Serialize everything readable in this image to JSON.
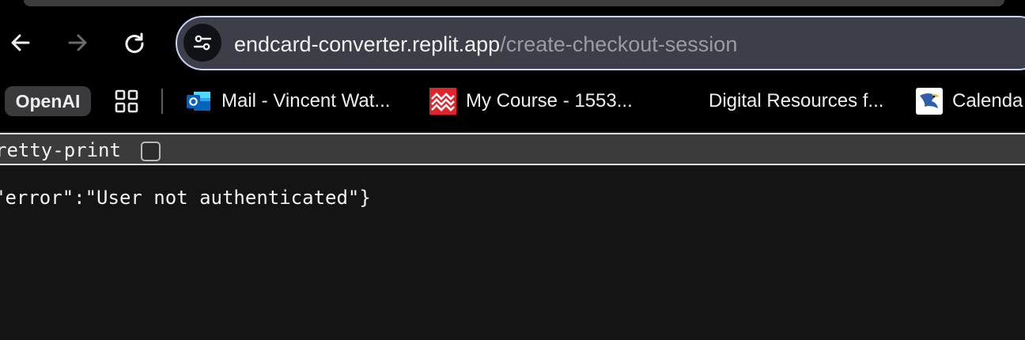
{
  "browser": {
    "url_host": "endcard-converter.replit.app",
    "url_path": "/create-checkout-session"
  },
  "bookmarks": {
    "chip_label": "OpenAI",
    "items": [
      {
        "label": "Mail - Vincent Wat...",
        "icon": "outlook-icon"
      },
      {
        "label": "My Course - 1553...",
        "icon": "mcgraw-hill-icon"
      },
      {
        "label": "Digital Resources f...",
        "icon": ""
      },
      {
        "label": "Calenda",
        "icon": "eagle-icon"
      }
    ]
  },
  "viewer": {
    "pretty_print_label": "retty-print",
    "pretty_print_checked": false,
    "body_text": "\"error\":\"User not authenticated\"}"
  },
  "colors": {
    "omnibox_border": "#c9d2ff",
    "page_background": "#141414"
  }
}
